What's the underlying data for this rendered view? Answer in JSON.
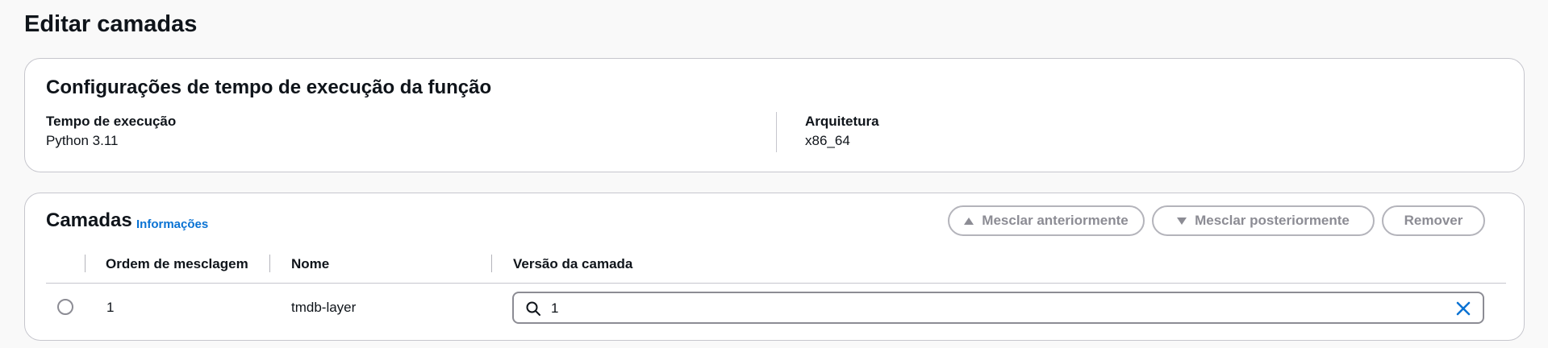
{
  "page": {
    "title": "Editar camadas"
  },
  "runtime_settings": {
    "title": "Configurações de tempo de execução da função",
    "runtime": {
      "label": "Tempo de execução",
      "value": "Python 3.11"
    },
    "architecture": {
      "label": "Arquitetura",
      "value": "x86_64"
    }
  },
  "layers": {
    "title": "Camadas",
    "info_link": "Informações",
    "buttons": {
      "merge_before": "Mesclar anteriormente",
      "merge_after": "Mesclar posteriormente",
      "remove": "Remover"
    },
    "columns": [
      "Ordem de mesclagem",
      "Nome",
      "Versão da camada"
    ],
    "rows": [
      {
        "order": "1",
        "name": "tmdb-layer",
        "version": "1",
        "selected": false
      }
    ]
  },
  "colors": {
    "link": "#0972d3",
    "disabled": "#8c8c94",
    "border": "#c6c6cd",
    "background": "#f9f9f9"
  },
  "icons": [
    "triangle-up-icon",
    "triangle-down-icon",
    "search-icon",
    "close-icon"
  ]
}
